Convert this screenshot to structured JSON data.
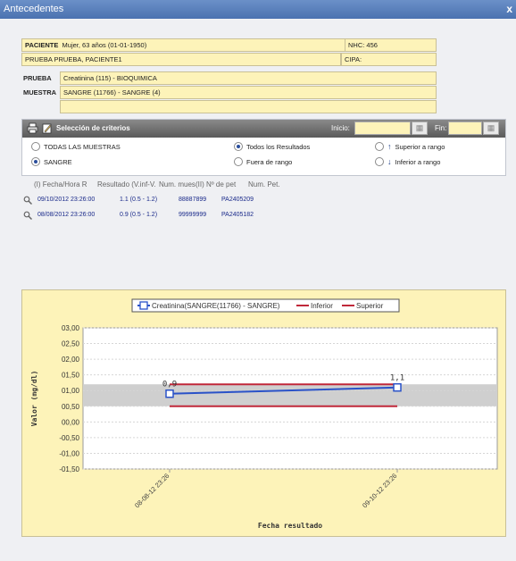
{
  "window": {
    "title": "Antecedentes",
    "close": "x"
  },
  "patient": {
    "label_paciente": "PACIENTE",
    "paciente_value": "Mujer, 63 años (01-01-1950)",
    "nhc": "NHC: 456",
    "name": "PRUEBA PRUEBA, PACIENTE1",
    "cipa": "CIPA:",
    "label_prueba": "PRUEBA",
    "prueba_value": "Creatinina (115) - BIOQUIMICA",
    "label_muestra": "MUESTRA",
    "muestra_value": "SANGRE (11766) - SANGRE (4)",
    "extra_value": ""
  },
  "criteria": {
    "title": "Selección de criterios",
    "inicio_label": "Inicio:",
    "fin_label": "Fin:",
    "inicio_value": "",
    "fin_value": "",
    "opt_todas": "TODAS LAS MUESTRAS",
    "opt_sangre": "SANGRE",
    "opt_todos": "Todos los Resultados",
    "opt_fuera": "Fuera de rango",
    "opt_superior": "Superior a rango",
    "opt_inferior": "Inferior a rango"
  },
  "grid": {
    "headers": [
      "(I) Fecha/Hora R",
      "Resultado (V.inf-V.",
      "Num. mues",
      "(II) Nº de pet",
      "Num. Pet."
    ],
    "rows": [
      [
        "09/10/2012 23:26:00",
        "1.1 (0.5 - 1.2)",
        "88887899",
        "PA2405209"
      ],
      [
        "08/08/2012 23:26:00",
        "0.9 (0.5 - 1.2)",
        "99999999",
        "PA2405182"
      ]
    ]
  },
  "chart_data": {
    "type": "line",
    "xlabel": "Fecha resultado",
    "ylabel": "Valor (mg/dl)",
    "x": [
      "08-08-12 23:26",
      "09-10-12 23:26"
    ],
    "series": [
      {
        "name": "Creatinina(SANGRE(11766) - SANGRE)",
        "values": [
          0.9,
          1.1
        ],
        "color": "#2a52c8"
      },
      {
        "name": "Inferior",
        "values": [
          0.5,
          0.5
        ],
        "color": "#c0283a"
      },
      {
        "name": "Superior",
        "values": [
          1.2,
          1.2
        ],
        "color": "#c0283a"
      }
    ],
    "data_labels": [
      "0,9",
      "1,1"
    ],
    "ylim": [
      -1.5,
      3.0
    ],
    "yticks": [
      "03,00",
      "02,50",
      "02,00",
      "01,50",
      "01,00",
      "00,50",
      "00,00",
      "-00,50",
      "-01,00",
      "-01,50"
    ],
    "normal_band": [
      0.5,
      1.2
    ],
    "band_color": "#cfcfcf",
    "grid": true,
    "legend_position": "top"
  }
}
